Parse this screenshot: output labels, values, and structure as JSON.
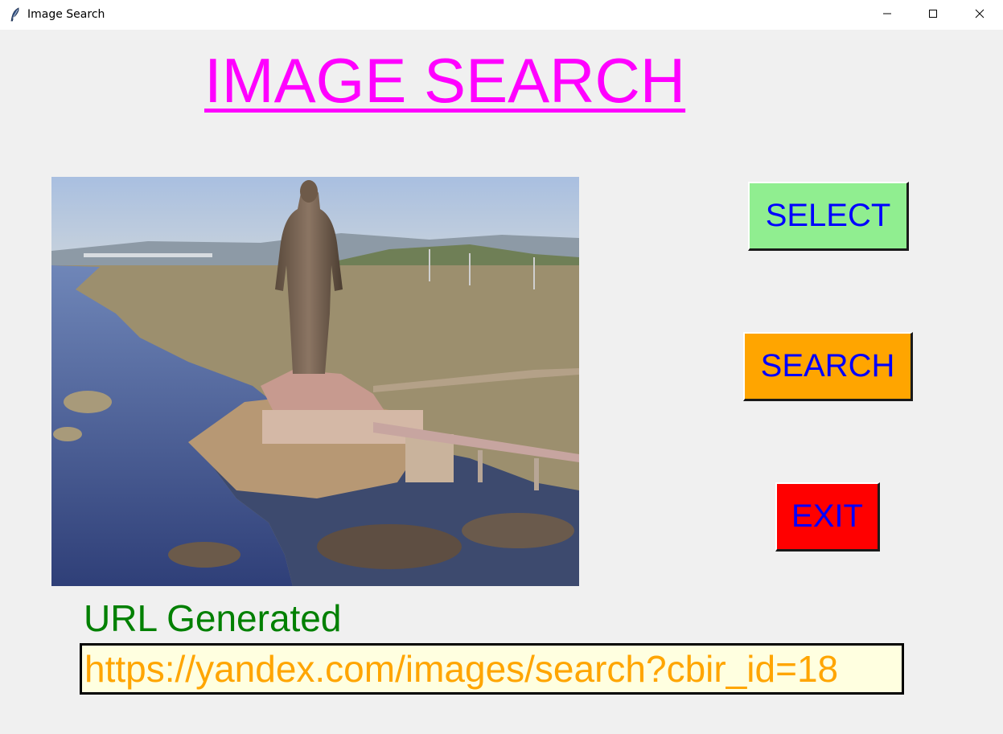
{
  "window": {
    "title": "Image Search",
    "controls": {
      "minimize": "minimize-icon",
      "maximize": "maximize-icon",
      "close": "close-icon"
    }
  },
  "main": {
    "heading": "IMAGE SEARCH",
    "preview_image": "statue-photo",
    "buttons": {
      "select_label": "SELECT",
      "search_label": "SEARCH",
      "exit_label": "EXIT"
    },
    "url_label": "URL Generated",
    "url_value": "https://yandex.com/images/search?cbir_id=18"
  },
  "colors": {
    "heading": "#ff00ff",
    "select_bg": "#90ee90",
    "search_bg": "#ffa500",
    "exit_bg": "#ff0000",
    "button_text": "#0000ff",
    "url_label": "#008000",
    "url_text": "#ffa500",
    "url_bg": "#ffffe0"
  }
}
